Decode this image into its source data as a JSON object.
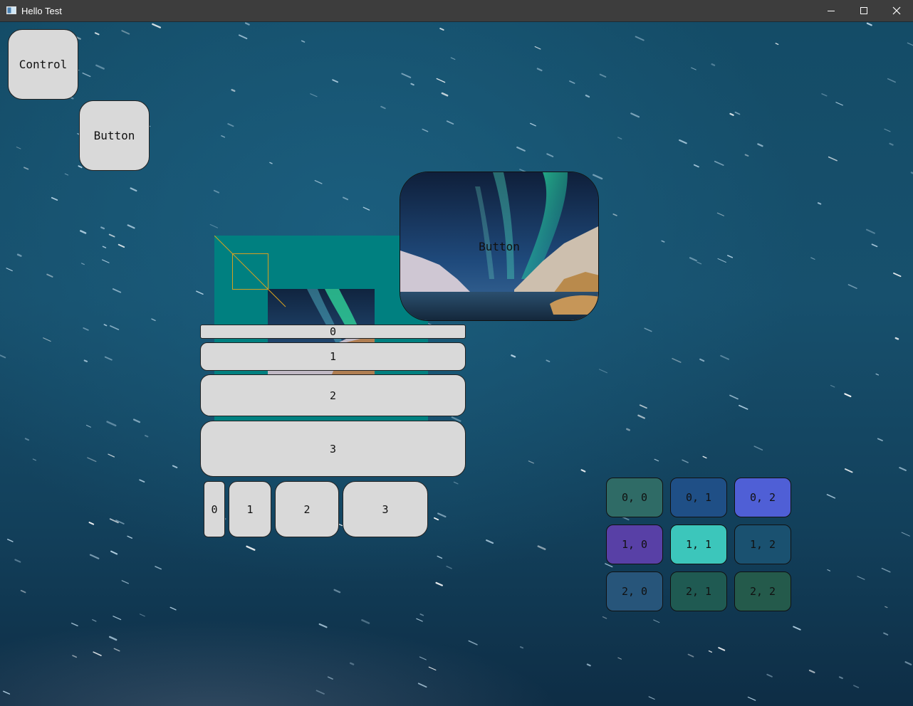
{
  "window": {
    "title": "Hello Test",
    "controls": {
      "minimize": "minimize",
      "maximize": "maximize",
      "close": "close"
    }
  },
  "widgets": {
    "control_label": "Control",
    "button_label": "Button",
    "image_button_label": "Button"
  },
  "vertical_list": [
    "0",
    "1",
    "2",
    "3"
  ],
  "horizontal_list": [
    "0",
    "1",
    "2",
    "3"
  ],
  "grid": [
    [
      {
        "label": "0, 0",
        "color": "#2f6b66"
      },
      {
        "label": "0, 1",
        "color": "#1f4f86"
      },
      {
        "label": "0, 2",
        "color": "#4f5fd6"
      }
    ],
    [
      {
        "label": "1, 0",
        "color": "#5840a6"
      },
      {
        "label": "1, 1",
        "color": "#3cc6bb"
      },
      {
        "label": "1, 2",
        "color": "#1a5170"
      }
    ],
    [
      {
        "label": "2, 0",
        "color": "#27557a"
      },
      {
        "label": "2, 1",
        "color": "#1f5a52"
      },
      {
        "label": "2, 2",
        "color": "#245a4b"
      }
    ]
  ],
  "colors": {
    "titlebar": "#3d3d3d",
    "widget_fill": "#d9d9d9",
    "teal_panel": "#008080",
    "diagonal_line": "#d6a020"
  }
}
